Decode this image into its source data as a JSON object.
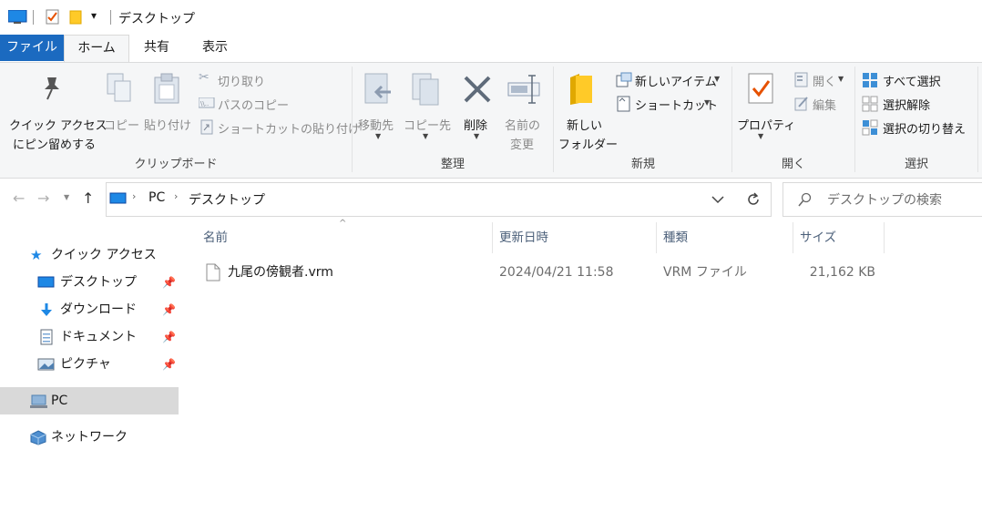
{
  "window": {
    "title": "デスクトップ",
    "qa_dropdown": "▾"
  },
  "ribbon_tabs": [
    "ファイル",
    "ホーム",
    "共有",
    "表示"
  ],
  "ribbon": {
    "clipboard": {
      "pin_line1": "クイック アクセス",
      "pin_line2": "にピン留めする",
      "copy": "コピー",
      "paste": "貼り付け",
      "cut": "切り取り",
      "copy_path": "パスのコピー",
      "paste_shortcut": "ショートカットの貼り付け",
      "label": "クリップボード"
    },
    "organize": {
      "move_to": "移動先",
      "copy_to": "コピー先",
      "delete": "削除",
      "rename_line1": "名前の",
      "rename_line2": "変更",
      "label": "整理"
    },
    "new": {
      "new_folder_line1": "新しい",
      "new_folder_line2": "フォルダー",
      "new_item": "新しいアイテム",
      "shortcut": "ショートカット",
      "label": "新規"
    },
    "open": {
      "properties": "プロパティ",
      "open": "開く",
      "edit": "編集",
      "label": "開く"
    },
    "select": {
      "select_all": "すべて選択",
      "select_none": "選択解除",
      "invert": "選択の切り替え",
      "label": "選択"
    }
  },
  "address": {
    "crumbs": [
      "PC",
      "デスクトップ"
    ],
    "search_placeholder": "デスクトップの検索"
  },
  "nav": {
    "quick_access": "クイック アクセス",
    "items": [
      "デスクトップ",
      "ダウンロード",
      "ドキュメント",
      "ピクチャ"
    ],
    "pc": "PC",
    "network": "ネットワーク"
  },
  "files": {
    "columns": [
      "名前",
      "更新日時",
      "種類",
      "サイズ"
    ],
    "rows": [
      {
        "name": "九尾の傍観者.vrm",
        "modified": "2024/04/21 11:58",
        "type": "VRM ファイル",
        "size": "21,162 KB"
      }
    ]
  },
  "colors": {
    "file_tab": "#1b6ac0",
    "selected_nav": "#d9d9d9",
    "ribbon_bg": "#f5f6f7"
  }
}
